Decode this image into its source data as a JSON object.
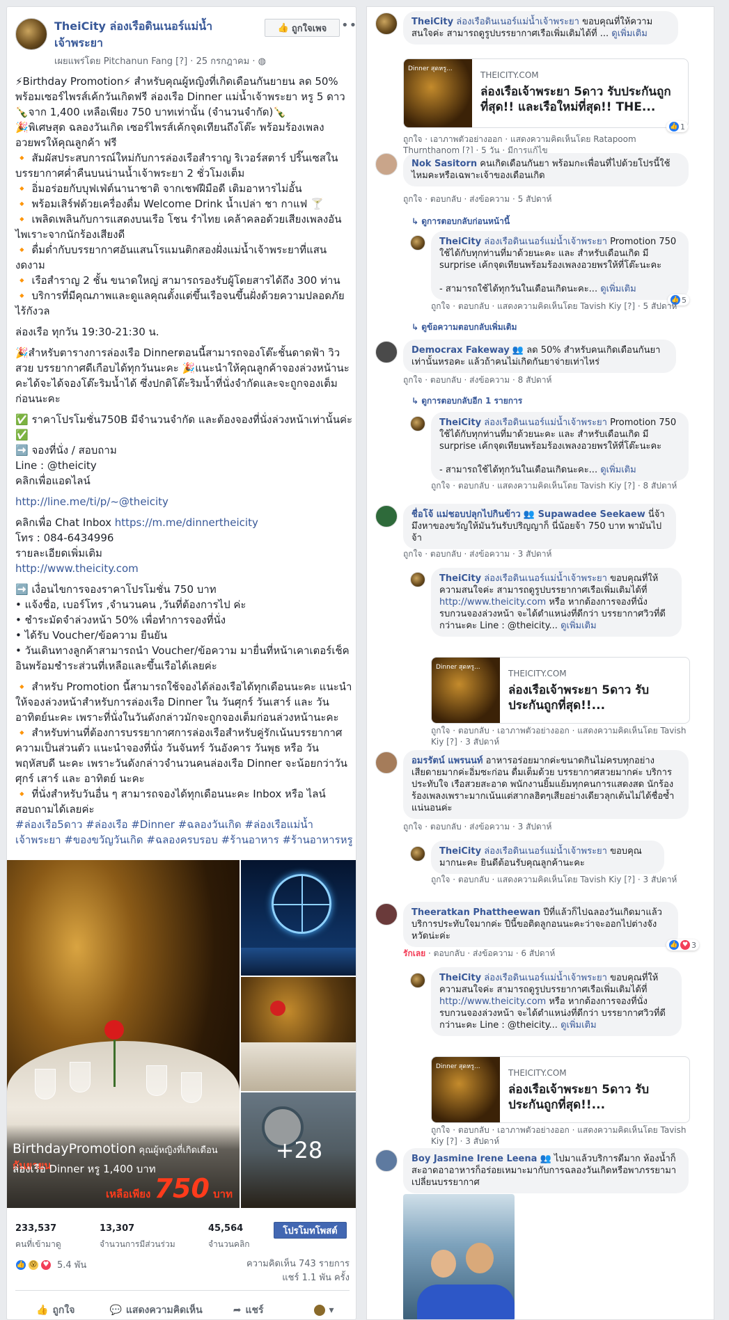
{
  "post": {
    "page_name": "TheiCity ล่องเรือดินเนอร์แม่น้ำเจ้าพระยา",
    "like_page_label": "ถูกใจเพจ",
    "published_by": "เผยแพร่โดย Pitchanun Fang [?] · 25 กรกฎาคม · ",
    "body": [
      "⚡Birthday Promotion⚡ สำหรับคุณผู้หญิงที่เกิดเดือนกันยายน ลด 50% พร้อมเซอร์ไพรส์เค้กวันเกิดฟรี ล่องเรือ Dinner แม่น้ำเจ้าพระยา หรู 5 ดาว 🍾จาก 1,400 เหลือเพียง 750 บาทเท่านั้น (จำนวนจำกัด)🍾",
      "🎉พิเศษสุด ฉลองวันเกิด เซอร์ไพรส์เค้กจุดเทียนถึงโต๊ะ พร้อมร้องเพลงอวยพรให้คุณลูกค้า ฟรี",
      "🔸 สัมผัสประสบการณ์ใหม่กับการล่องเรือสำราญ ริเวอร์สตาร์ ปริ๊นเซสในบรรยากาศค่ำคืนบนน่านน้ำเจ้าพระยา 2 ชั่วโมงเต็ม",
      "🔸 อิ่มอร่อยกับบุฟเฟ่ต์นานาชาติ จากเชฟฝีมือดี เติมอาหารไม่อั้น",
      "🔸 พร้อมเสิร์ฟด้วยเครื่องดื่ม Welcome Drink น้ำเปล่า ชา กาแฟ 🍸",
      "🔸 เพลิดเพลินกับการแสดงบนเรือ โชน รำไทย เคล้าคลอด้วยเสียงเพลงอันไพเราะจากนักร้องเสียงดี",
      "🔸 ดื่มด่ำกับบรรยากาศอันแสนโรแมนติกสองฝั่งแม่น้ำเจ้าพระยาที่แสนงดงาม",
      "🔸 เรือสำราญ 2 ชั้น ขนาดใหญ่ สามารถรองรับผู้โดยสารได้ถึง 300 ท่าน",
      "🔸 บริการที่มีคุณภาพและดูแลคุณตั้งแต่ขึ้นเรือจนขึ้นฝั่งด้วยความปลอดภัยไร้กังวล",
      "ล่องเรือ ทุกวัน 19:30-21:30 น.",
      "🎉สำหรับตารางการล่องเรือ Dinnerตอนนี้สามารถจองโต๊ะชั้นดาดฟ้า วิวสวย บรรยากาศดีเกือบได้ทุกวันนะคะ 🎉แนะนำให้คุณลูกค้าจองล่วงหน้านะคะได้จะได้จองโต๊ะริมน้ำได้ ซึ่งปกติโต๊ะริมน้ำที่นั่งจำกัดและจะถูกจองเต็มก่อนนะคะ",
      "✅ ราคาโปรโมชั่น750B มีจำนวนจำกัด และต้องจองที่นั่งล่วงหน้าเท่านั้นค่ะ ✅",
      "➡️ จองที่นั่ง / สอบถาม",
      "Line : @theicity",
      "คลิกเพื่อแอดไลน์",
      "http://line.me/ti/p/~@theicity",
      "คลิกเพื่อ Chat Inbox ",
      "https://m.me/dinnertheicity",
      "โทร : 084-6434996",
      "รายละเอียดเพิ่มเติม",
      "http://www.theicity.com",
      "➡️ เงื่อนไขการจองราคาโปรโมชั่น 750 บาท",
      "• แจ้งชื่อ, เบอร์โทร ,จำนวนคน ,วันที่ต้องการไป ค่ะ",
      "• ชำระมัดจำล่วงหน้า 50% เพื่อทำการจองที่นั่ง",
      "• ได้รับ Voucher/ข้อความ ยืนยัน",
      "• วันเดินทางลูกค้าสามารถนำ Voucher/ข้อความ มายื่นที่หน้าเคาเตอร์เช็คอินพร้อมชำระส่วนที่เหลือและขึ้นเรือได้เลยค่ะ",
      "🔸 สำหรับ Promotion นี้สามารถใช้จองได้ล่องเรือได้ทุกเดือนนะคะ แนะนำให้จองล่วงหน้าสำหรับการล่องเรือ Dinner ใน วันศุกร์ วันเสาร์ และ วันอาทิตย์นะคะ เพราะที่นั่งในวันดังกล่าวมักจะถูกจองเต็มก่อนล่วงหน้านะคะ",
      "🔸 สำหรับท่านที่ต้องการบรรยากาศการล่องเรือสำหรับคู่รักเน้นบรรยากาศความเป็นส่วนตัว แนะนำจองที่นั่ง วันจันทร์ วันอังคาร วันพุธ หรือ วันพฤหัสบดี นะคะ เพราะวันดังกล่าวจำนวนคนล่องเรือ Dinner จะน้อยกว่าวันศุกร์ เสาร์ และ อาทิตย์ นะคะ",
      "🔸 ที่นั่งสำหรับวันอื่น ๆ สามารถจองได้ทุกเดือนนะคะ Inbox หรือ ไลน์สอบถามได้เลยค่ะ",
      "#ล่องเรือ5ดาว #ล่องเรือ #Dinner #ฉลองวันเกิด #ล่องเรือแม่น้ำเจ้าพระยา #ของขวัญวันเกิด #ฉลองครบรอบ #ร้านอาหาร #ร้านอาหารหรู"
    ],
    "photo_promo": {
      "title": "BirthdayPromotion",
      "small": " คุณผู้หญิงที่เกิดเดือน ",
      "month": "กันยายน",
      "line2": "ล่องเรือ Dinner หรู 1,400 บาท",
      "line3_prefix": "เหลือเพียง ",
      "price": "750",
      "unit": " บาท"
    },
    "more_photos": "+28",
    "stats": [
      {
        "value": "233,537",
        "label": "คนที่เข้ามาดู"
      },
      {
        "value": "13,307",
        "label": "จำนวนการมีส่วนร่วม"
      },
      {
        "value": "45,564",
        "label": "จำนวนคลิก"
      }
    ],
    "promote_label": "โปรโมทโพสต์",
    "reaction_count": "5.4 พัน",
    "comments_count": "ความคิดเห็น 743 รายการ",
    "shares_count": "แชร์ 1.1 พัน ครั้ง",
    "actions": {
      "like": "ถูกใจ",
      "comment": "แสดงความคิดเห็น",
      "share": "แชร์"
    }
  },
  "comments": {
    "c1": {
      "name": "TheiCity",
      "name2": " ล่องเรือดินเนอร์แม่น้ำเจ้าพระยา",
      "text": " ขอบคุณที่ให้ความสนใจค่ะ สามารถดูรูปบรรยากาศเรือเพิ่มเติมได้ที่ ... ",
      "more": "ดูเพิ่มเติม",
      "card_domain": "THEICITY.COM",
      "card_title": "ล่องเรือเจ้าพระยา 5ดาว รับประกันถูกที่สุด!! และเรือใหม่ที่สุด!! THE...",
      "thumb_text": "Dinner สุดหรู...",
      "meta": "ถูกใจ · เอาภาพตัวอย่างออก · แสดงความคิดเห็นโดย Ratapoom Thurnthanom [?] · 5 วัน · มีการแก้ไข",
      "react": "1"
    },
    "c2": {
      "name": "Nok Sasitorn",
      "text": " คนเกิดเดือนกันยา พร้อมกะเพื่อนที่ไปด้วยโปรนี้ใช้ไหมคะหรือเฉพาะเจ้าของเดือนเกิด",
      "meta": "ถูกใจ · ตอบกลับ · ส่งข้อความ · 5 สัปดาห์",
      "prev_replies": "↳ ดูการตอบกลับก่อนหน้านี้"
    },
    "c2r": {
      "name": "TheiCity",
      "name2": " ล่องเรือดินเนอร์แม่น้ำเจ้าพระยา",
      "text": " Promotion 750 ใช้ได้กับทุกท่านที่มาด้วยนะคะ และ สำหรับเดือนเกิด มี surprise เค้กจุดเทียนพร้อมร้องเพลงอวยพรให้ที่โต๊ะนะคะ",
      "text2": "- สามารถใช้ได้ทุกวันในเดือนเกิดนะคะ... ",
      "more": "ดูเพิ่มเติม",
      "meta": "ถูกใจ · ตอบกลับ · แสดงความคิดเห็นโดย Tavish Kiy [?] · 5 สัปดาห์",
      "react": "5",
      "more_replies": "↳ ดูข้อความตอบกลับเพิ่มเติม"
    },
    "c3": {
      "name": "Democrax Fakeway",
      "text": " ลด 50% สำหรับคนเกิดเดือนกันยาเท่านั้นหรอคะ แล้วถ้าคนไม่เกิดกันยาจ่ายเท่าไหร่",
      "meta": "ถูกใจ · ตอบกลับ · ส่งข้อความ · 8 สัปดาห์",
      "prev_replies": "↳ ดูการตอบกลับอีก 1 รายการ"
    },
    "c3r": {
      "name": "TheiCity",
      "name2": " ล่องเรือดินเนอร์แม่น้ำเจ้าพระยา",
      "text": " Promotion 750 ใช้ได้กับทุกท่านที่มาด้วยนะคะ และ สำหรับเดือนเกิด มี surprise เค้กจุดเทียนพร้อมร้องเพลงอวยพรให้ที่โต๊ะนะคะ",
      "text2": "- สามารถใช้ได้ทุกวันในเดือนเกิดนะคะ... ",
      "more": "ดูเพิ่มเติม",
      "meta": "ถูกใจ · ตอบกลับ · แสดงความคิดเห็นโดย Tavish Kiy [?] · 8 สัปดาห์"
    },
    "c4": {
      "name": "ชื่อโจ้ แม่ชอบปลุกไปกินข้าว",
      "tag": " Supawadee Seekaew",
      "text": " นี่จ้ามึงหาของขวัญให้มันวันรับปริญญาก็ นี่น้อยจ้า 750 บาท พามันไปจ้า",
      "meta": "ถูกใจ · ตอบกลับ · ส่งข้อความ · 3 สัปดาห์"
    },
    "c4r": {
      "name": "TheiCity",
      "name2": " ล่องเรือดินเนอร์แม่น้ำเจ้าพระยา",
      "text": " ขอบคุณที่ให้ความสนใจค่ะ สามารถดูรูปบรรยากาศเรือเพิ่มเติมได้ที่ ",
      "link": "http://www.theicity.com",
      "text2": " หรือ หากต้องการจองที่นั่งรบกวนจองล่วงหน้า จะได้ตำแหน่งที่ดีกว่า บรรยากาศวิวที่ดีกว่านะคะ Line : @theicity... ",
      "more": "ดูเพิ่มเติม",
      "card_domain": "THEICITY.COM",
      "card_title": "ล่องเรือเจ้าพระยา 5ดาว รับประกันถูกที่สุด!!...",
      "thumb_text": "Dinner สุดหรู...",
      "meta": "ถูกใจ · ตอบกลับ · เอาภาพตัวอย่างออก · แสดงความคิดเห็นโดย Tavish Kiy [?] · 3 สัปดาห์"
    },
    "c5": {
      "name": "อมรรัตน์ แพรนนท์",
      "text": " อาหารอร่อยมากค่ะขนาดกินไม่ครบทุกอย่าง เสียดายมากค่ะอิ่มซะก่อน ดื่มเต็มด้วย บรรยากาศสวยมากค่ะ บริการประทับใจ เรือสวยสะอาด พนักงานยิ้มแย้มทุกคนการแสดงสด นักร้องร้องเพลงเพราะมากเน้นแต่สากลฮิตๆเสียอย่างเดียวลุกเต้นไม่ได้ชื่อซ้ำแน่นอนค่ะ",
      "meta": "ถูกใจ · ตอบกลับ · ส่งข้อความ · 3 สัปดาห์"
    },
    "c5r": {
      "name": "TheiCity",
      "name2": " ล่องเรือดินเนอร์แม่น้ำเจ้าพระยา",
      "text": " ขอบคุณมากนะคะ ยินดีต้อนรับคุณลูกค้านะคะ",
      "meta": "ถูกใจ · ตอบกลับ · แสดงความคิดเห็นโดย Tavish Kiy [?] · 3 สัปดาห์"
    },
    "c6": {
      "name": "Theeratkan Phattheewan",
      "text": " ปีที่แล้วก็ไปฉลองวันเกิดมาแล้ว บริการประทับใจมากค่ะ ปีนี้ขอติดลูกอนนะคะว่าจะออกไปต่างจังหวัดน่ะค่ะ",
      "meta_red": "รักเลย",
      "meta": " · ตอบกลับ · ส่งข้อความ · 6 สัปดาห์",
      "react": "3"
    },
    "c6r": {
      "name": "TheiCity",
      "name2": " ล่องเรือดินเนอร์แม่น้ำเจ้าพระยา",
      "text": " ขอบคุณที่ให้ความสนใจค่ะ สามารถดูรูปบรรยากาศเรือเพิ่มเติมได้ที่ ",
      "link": "http://www.theicity.com",
      "text2": " หรือ หากต้องการจองที่นั่งรบกวนจองล่วงหน้า จะได้ตำแหน่งที่ดีกว่า บรรยากาศวิวที่ดีกว่านะคะ Line : @theicity... ",
      "more": "ดูเพิ่มเติม",
      "card_domain": "THEICITY.COM",
      "card_title": "ล่องเรือเจ้าพระยา 5ดาว รับประกันถูกที่สุด!!...",
      "thumb_text": "Dinner สุดหรู...",
      "meta": "ถูกใจ · ตอบกลับ · เอาภาพตัวอย่างออก · แสดงความคิดเห็นโดย Tavish Kiy [?] · 3 สัปดาห์"
    },
    "c7": {
      "name": "Boy Jasmine Irene Leena",
      "text": " ไปมาแล้วบริการดีมาก ห้องน้ำก็สะอาดอาอาหารก็อร่อยเหมาะมากับการฉลองวันเกิดหรือพาภรรยามาเปลี่ยนบรรยากาศ"
    }
  },
  "colors": {
    "facebook_blue": "#4267b2",
    "link": "#385898",
    "background": "#e9ebee"
  }
}
